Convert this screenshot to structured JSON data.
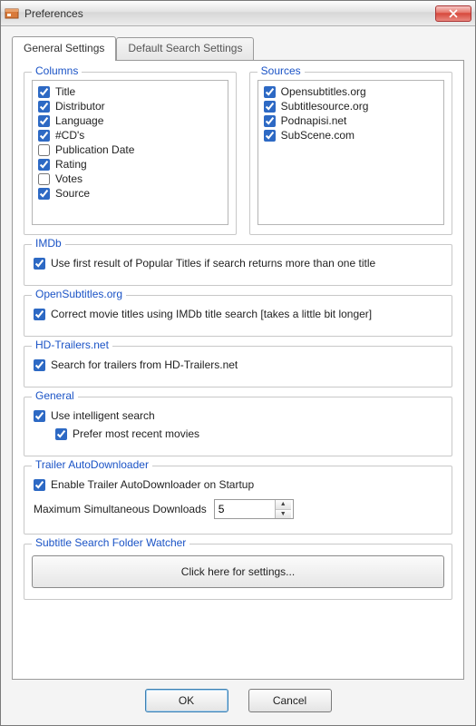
{
  "window": {
    "title": "Preferences"
  },
  "tabs": {
    "general": "General Settings",
    "default_search": "Default Search Settings"
  },
  "groups": {
    "columns": "Columns",
    "sources": "Sources",
    "imdb": "IMDb",
    "opensubtitles": "OpenSubtitles.org",
    "hdtrailers": "HD-Trailers.net",
    "general": "General",
    "trailer_autodl": "Trailer AutoDownloader",
    "subtitle_watcher": "Subtitle Search Folder Watcher"
  },
  "columns": [
    {
      "label": "Title",
      "checked": true
    },
    {
      "label": "Distributor",
      "checked": true
    },
    {
      "label": "Language",
      "checked": true
    },
    {
      "label": "#CD's",
      "checked": true
    },
    {
      "label": "Publication Date",
      "checked": false
    },
    {
      "label": "Rating",
      "checked": true
    },
    {
      "label": "Votes",
      "checked": false
    },
    {
      "label": "Source",
      "checked": true
    }
  ],
  "sources": [
    {
      "label": "Opensubtitles.org",
      "checked": true
    },
    {
      "label": "Subtitlesource.org",
      "checked": true
    },
    {
      "label": "Podnapisi.net",
      "checked": true
    },
    {
      "label": "SubScene.com",
      "checked": true
    }
  ],
  "imdb": {
    "use_first_result": {
      "label": "Use first result of Popular Titles if search returns more than one title",
      "checked": true
    }
  },
  "opensubtitles": {
    "correct_titles": {
      "label": "Correct movie titles using IMDb title search [takes a little bit longer]",
      "checked": true
    }
  },
  "hdtrailers": {
    "search_trailers": {
      "label": "Search for trailers from HD-Trailers.net",
      "checked": true
    }
  },
  "general": {
    "intelligent_search": {
      "label": "Use intelligent search",
      "checked": true
    },
    "prefer_recent": {
      "label": "Prefer most recent movies",
      "checked": true
    }
  },
  "trailer_autodl": {
    "enable_startup": {
      "label": "Enable Trailer AutoDownloader on Startup",
      "checked": true
    },
    "max_label": "Maximum Simultaneous Downloads",
    "max_value": "5"
  },
  "subtitle_watcher": {
    "settings_button": "Click here for settings..."
  },
  "buttons": {
    "ok": "OK",
    "cancel": "Cancel"
  }
}
